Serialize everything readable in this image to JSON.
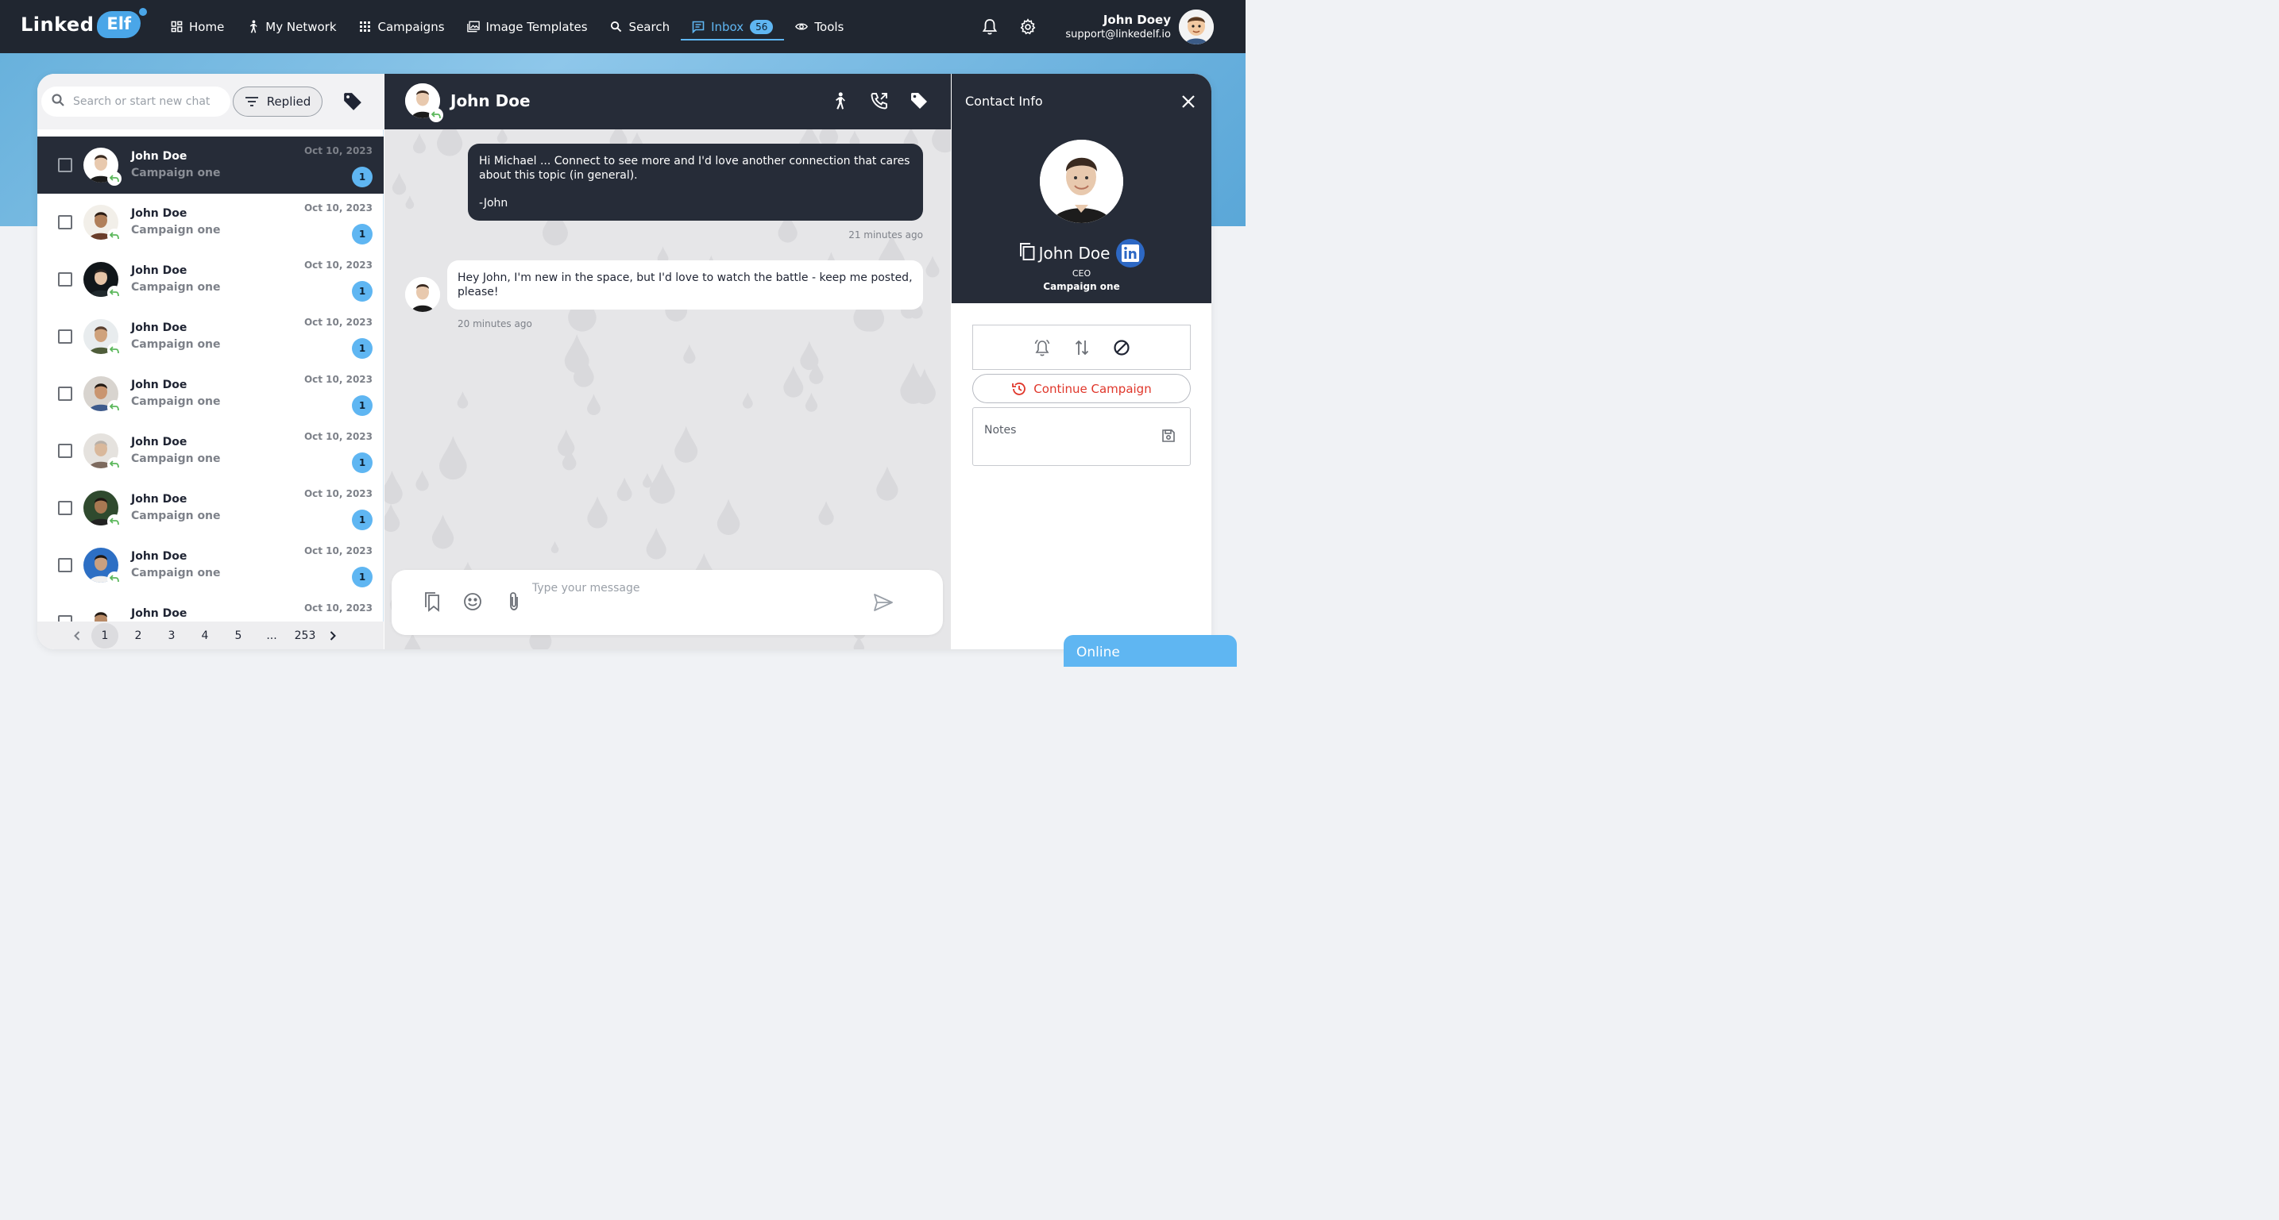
{
  "app": {
    "logo_part1": "Linked",
    "logo_part2": "Elf"
  },
  "nav": {
    "items": [
      {
        "label": "Home",
        "icon": "grid-icon"
      },
      {
        "label": "My Network",
        "icon": "person-walking-icon"
      },
      {
        "label": "Campaigns",
        "icon": "dots-grid-icon"
      },
      {
        "label": "Image Templates",
        "icon": "image-icon"
      },
      {
        "label": "Search",
        "icon": "search-icon"
      },
      {
        "label": "Inbox",
        "icon": "chat-icon",
        "badge": "56",
        "active": true
      },
      {
        "label": "Tools",
        "icon": "eye-icon"
      }
    ]
  },
  "user": {
    "name": "John Doey",
    "email": "support@linkedelf.io"
  },
  "sidebar": {
    "search_placeholder": "Search or start new chat",
    "filter_label": "Replied",
    "chats": [
      {
        "name": "John Doe",
        "campaign": "Campaign one",
        "date": "Oct 10, 2023",
        "count": "1",
        "active": true,
        "skin": "#e8c9ae",
        "hair": "#3a2a20",
        "bg": "#ffffff",
        "shirt": "#1c1c1c"
      },
      {
        "name": "John Doe",
        "campaign": "Campaign one",
        "date": "Oct 10, 2023",
        "count": "1",
        "skin": "#b07f5a",
        "hair": "#2b1c14",
        "bg": "#f2efe9",
        "shirt": "#6a3d2a"
      },
      {
        "name": "John Doe",
        "campaign": "Campaign one",
        "date": "Oct 10, 2023",
        "count": "1",
        "skin": "#e6c3a6",
        "hair": "#2b2320",
        "bg": "#11161a",
        "shirt": "#20282c"
      },
      {
        "name": "John Doe",
        "campaign": "Campaign one",
        "date": "Oct 10, 2023",
        "count": "1",
        "skin": "#cfa27c",
        "hair": "#5a4030",
        "bg": "#e8ecee",
        "shirt": "#4f5d3a"
      },
      {
        "name": "John Doe",
        "campaign": "Campaign one",
        "date": "Oct 10, 2023",
        "count": "1",
        "skin": "#c99570",
        "hair": "#231a14",
        "bg": "#d8d4cf",
        "shirt": "#3d5a8c"
      },
      {
        "name": "John Doe",
        "campaign": "Campaign one",
        "date": "Oct 10, 2023",
        "count": "1",
        "skin": "#d9b89b",
        "hair": "#b8b0a8",
        "bg": "#e5e2de",
        "shirt": "#7d6a5e"
      },
      {
        "name": "John Doe",
        "campaign": "Campaign one",
        "date": "Oct 10, 2023",
        "count": "1",
        "skin": "#a87852",
        "hair": "#1e1612",
        "bg": "#2f4a2e",
        "shirt": "#222222"
      },
      {
        "name": "John Doe",
        "campaign": "Campaign one",
        "date": "Oct 10, 2023",
        "count": "1",
        "skin": "#caa080",
        "hair": "#1f1712",
        "bg": "#2d6fc4",
        "shirt": "#f0f0f0"
      },
      {
        "name": "John Doe",
        "campaign": "",
        "date": "Oct 10, 2023",
        "count": "",
        "skin": "#b88a66",
        "hair": "#231a14",
        "bg": "#ffffff",
        "shirt": "#333333"
      }
    ],
    "pages": [
      "1",
      "2",
      "3",
      "4",
      "5",
      "...",
      "253"
    ],
    "current_page": "1"
  },
  "chat": {
    "contact_name": "John Doe",
    "messages": [
      {
        "direction": "out",
        "lines": [
          "Hi Michael ... Connect to see more and I'd love another connection that cares about this topic (in general).",
          "-John"
        ],
        "time": "21 minutes ago"
      },
      {
        "direction": "in",
        "lines": [
          "Hey John, I'm new in the space, but I'd love to watch the battle - keep me posted, please!"
        ],
        "time": "20 minutes ago"
      }
    ],
    "composer_placeholder": "Type your message"
  },
  "contact_info": {
    "title": "Contact Info",
    "name": "John Doe",
    "role": "CEO",
    "campaign": "Campaign one",
    "continue_label": "Continue Campaign",
    "notes_placeholder": "Notes"
  },
  "status": {
    "online_label": "Online"
  },
  "colors": {
    "topbar": "#202630",
    "accent": "#5fb6f2",
    "dark_panel": "#262c38",
    "danger": "#e0372b",
    "linkedin": "#2d68c4"
  }
}
